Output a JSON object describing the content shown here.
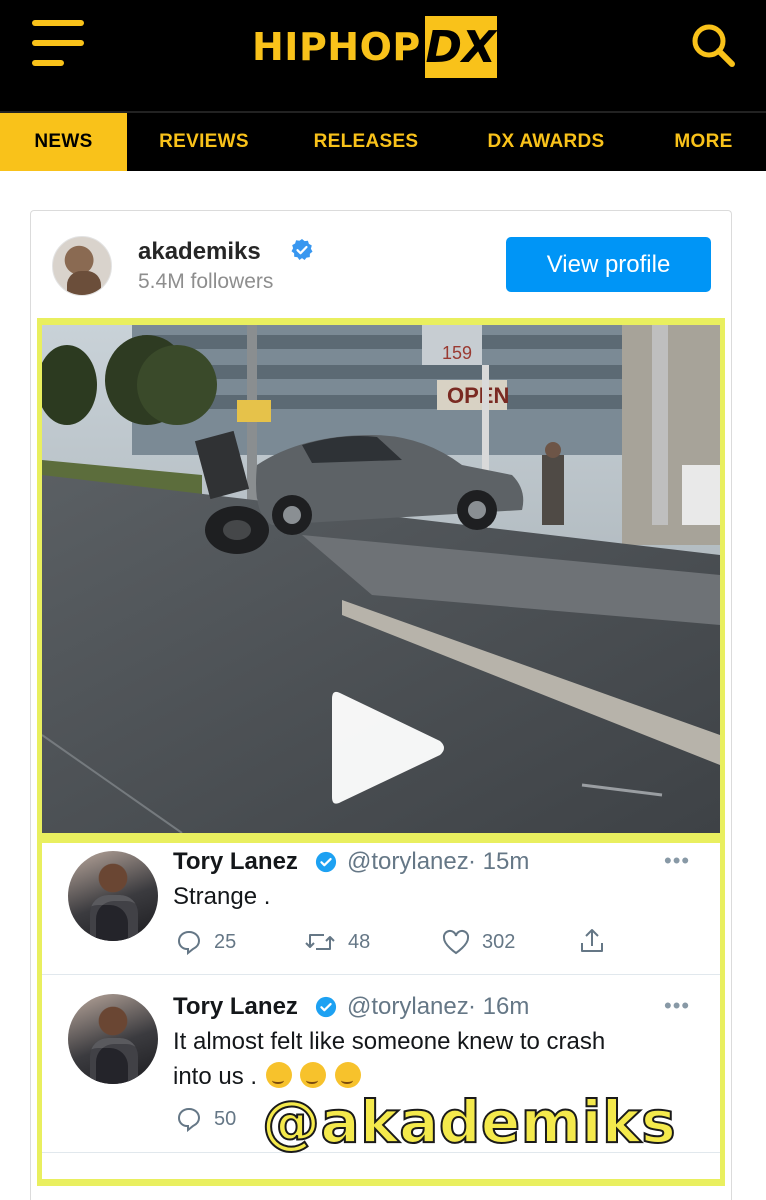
{
  "header": {
    "logo_text": "HIPHOP",
    "logo_mark": "DX",
    "menu_icon": "hamburger-menu-icon",
    "search_icon": "search-icon",
    "brand_color": "#f9c21a"
  },
  "nav": {
    "items": [
      {
        "label": "NEWS",
        "active": true
      },
      {
        "label": "REVIEWS"
      },
      {
        "label": "RELEASES"
      },
      {
        "label": "DX AWARDS"
      },
      {
        "label": "MORE"
      }
    ]
  },
  "embed": {
    "account": "akademiks",
    "followers": "5.4M followers",
    "view_profile": "View profile",
    "watermark": "@akademiks",
    "video_signs": [
      "OPEN",
      "159"
    ]
  },
  "tweets": [
    {
      "name": "Tory Lanez",
      "handle": "@torylanez",
      "time": "· 15m",
      "text": "Strange .",
      "replies": "25",
      "retweets": "48",
      "likes": "302"
    },
    {
      "name": "Tory Lanez",
      "handle": "@torylanez",
      "time": "· 16m",
      "text_line1": "It almost felt like someone knew to crash",
      "text_line2": "into us .",
      "replies": "50"
    }
  ]
}
